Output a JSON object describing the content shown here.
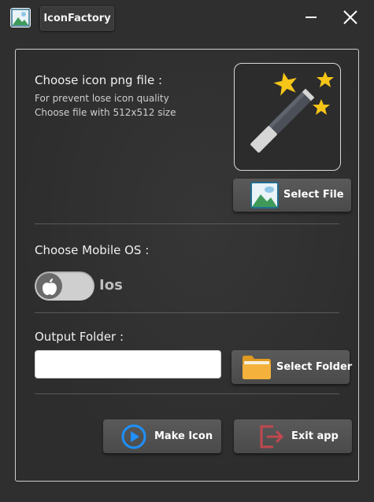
{
  "window": {
    "title": "IconFactory"
  },
  "image_section": {
    "heading": "Choose icon png file :",
    "hint_line1": "For prevent lose icon quality",
    "hint_line2": "Choose file with 512x512 size",
    "select_file_label": "Select File"
  },
  "os_section": {
    "heading": "Choose Mobile OS :",
    "selected_os": "Ios",
    "toggle_on": false
  },
  "output_section": {
    "heading": "Output Folder :",
    "folder_value": "",
    "select_folder_label": "Select Folder"
  },
  "actions": {
    "make_icon_label": "Make Icon",
    "exit_label": "Exit app"
  },
  "colors": {
    "background": "#2f2f2f",
    "button": "#555555",
    "play_accent": "#1e90ff",
    "exit_accent": "#c0484f",
    "folder_accent": "#f0b23a",
    "star": "#f5c518"
  },
  "icons": [
    "app-image-icon",
    "minimize-icon",
    "close-icon",
    "magic-wand-icon",
    "image-icon",
    "apple-icon",
    "folder-icon",
    "play-icon",
    "exit-icon"
  ]
}
